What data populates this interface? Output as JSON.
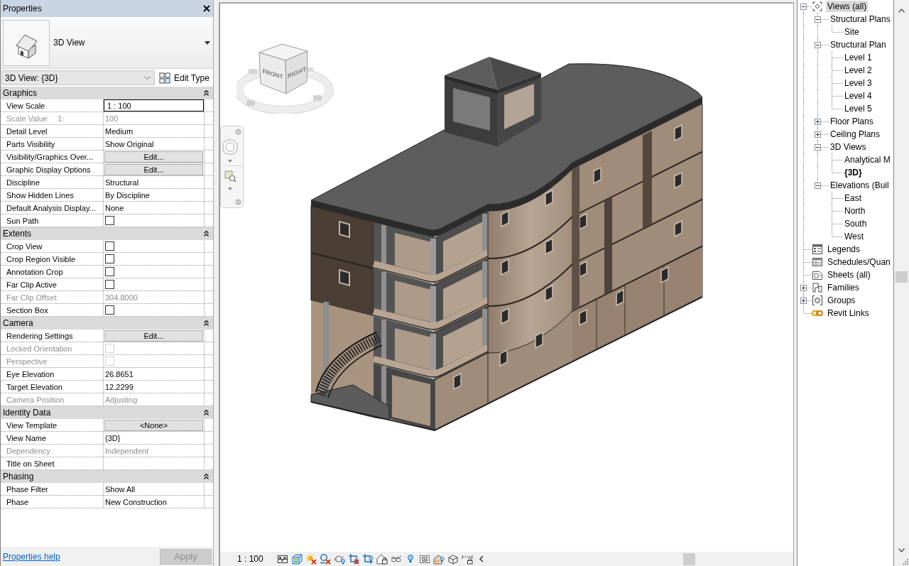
{
  "properties": {
    "title": "Properties",
    "type": {
      "name": "3D View"
    },
    "instance": {
      "value": "3D View: {3D}"
    },
    "edit_type": "Edit Type",
    "groups": [
      {
        "name": "Graphics",
        "expanded": true,
        "rows": [
          {
            "label": "View Scale",
            "kind": "input",
            "value": "1 : 100",
            "disabled": false
          },
          {
            "label": "Scale Value",
            "unit": "1:",
            "kind": "text",
            "value": "100",
            "disabled": true
          },
          {
            "label": "Detail Level",
            "kind": "text",
            "value": "Medium",
            "disabled": false
          },
          {
            "label": "Parts Visibility",
            "kind": "text",
            "value": "Show Original",
            "disabled": false
          },
          {
            "label": "Visibility/Graphics Over...",
            "kind": "button",
            "value": "Edit...",
            "disabled": false
          },
          {
            "label": "Graphic Display Options",
            "kind": "button",
            "value": "Edit...",
            "disabled": false
          },
          {
            "label": "Discipline",
            "kind": "text",
            "value": "Structural",
            "disabled": false
          },
          {
            "label": "Show Hidden Lines",
            "kind": "text",
            "value": "By Discipline",
            "disabled": false
          },
          {
            "label": "Default Analysis Display...",
            "kind": "text",
            "value": "None",
            "disabled": false
          },
          {
            "label": "Sun Path",
            "kind": "checkbox",
            "checked": false,
            "disabled": false
          }
        ]
      },
      {
        "name": "Extents",
        "expanded": true,
        "rows": [
          {
            "label": "Crop View",
            "kind": "checkbox",
            "checked": false,
            "disabled": false
          },
          {
            "label": "Crop Region Visible",
            "kind": "checkbox",
            "checked": false,
            "disabled": false
          },
          {
            "label": "Annotation Crop",
            "kind": "checkbox",
            "checked": false,
            "disabled": false
          },
          {
            "label": "Far Clip Active",
            "kind": "checkbox",
            "checked": false,
            "disabled": false
          },
          {
            "label": "Far Clip Offset",
            "kind": "text",
            "value": "304.8000",
            "disabled": true
          },
          {
            "label": "Section Box",
            "kind": "checkbox",
            "checked": false,
            "disabled": false
          }
        ]
      },
      {
        "name": "Camera",
        "expanded": true,
        "rows": [
          {
            "label": "Rendering Settings",
            "kind": "button",
            "value": "Edit...",
            "disabled": false
          },
          {
            "label": "Locked Orientation",
            "kind": "checkbox",
            "checked": false,
            "disabled": true
          },
          {
            "label": "Perspective",
            "kind": "checkbox",
            "checked": false,
            "disabled": true
          },
          {
            "label": "Eye Elevation",
            "kind": "text",
            "value": "26.8651",
            "disabled": false
          },
          {
            "label": "Target Elevation",
            "kind": "text",
            "value": "12.2299",
            "disabled": false
          },
          {
            "label": "Camera Position",
            "kind": "text",
            "value": "Adjusting",
            "disabled": true
          }
        ]
      },
      {
        "name": "Identity Data",
        "expanded": true,
        "rows": [
          {
            "label": "View Template",
            "kind": "button",
            "value": "<None>",
            "disabled": false
          },
          {
            "label": "View Name",
            "kind": "text",
            "value": "{3D}",
            "disabled": false
          },
          {
            "label": "Dependency",
            "kind": "text",
            "value": "Independent",
            "disabled": true
          },
          {
            "label": "Title on Sheet",
            "kind": "text",
            "disabled": false
          }
        ]
      },
      {
        "name": "Phasing",
        "expanded": true,
        "rows": [
          {
            "label": "Phase Filter",
            "kind": "text",
            "value": "Show All",
            "disabled": false
          },
          {
            "label": "Phase",
            "kind": "text",
            "value": "New Construction",
            "disabled": false
          }
        ]
      }
    ],
    "help_link": "Properties help",
    "apply": {
      "label": "Apply",
      "disabled": true
    }
  },
  "viewport": {
    "view_cube": {
      "faces": [
        "FRONT",
        "RIGHT"
      ]
    },
    "view_scale": "1 : 100"
  },
  "project_browser": {
    "items": [
      {
        "label": "Views (all)",
        "kind": "views",
        "expanded": true,
        "selected": true,
        "active": false,
        "children": [
          {
            "label": "Structural Plans",
            "expanded": true,
            "selected": false,
            "active": false,
            "children": [
              {
                "label": "Site",
                "selected": false,
                "active": false
              }
            ]
          },
          {
            "label": "Structural Plan",
            "expanded": true,
            "selected": false,
            "active": false,
            "children": [
              {
                "label": "Level 1",
                "selected": false,
                "active": false
              },
              {
                "label": "Level 2",
                "selected": false,
                "active": false
              },
              {
                "label": "Level 3",
                "selected": false,
                "active": false
              },
              {
                "label": "Level 4",
                "selected": false,
                "active": false
              },
              {
                "label": "Level 5",
                "selected": false,
                "active": false
              }
            ]
          },
          {
            "label": "Floor Plans",
            "expanded": false,
            "selected": false,
            "active": false
          },
          {
            "label": "Ceiling Plans",
            "expanded": false,
            "selected": false,
            "active": false
          },
          {
            "label": "3D Views",
            "expanded": true,
            "selected": false,
            "active": false,
            "children": [
              {
                "label": "Analytical M",
                "selected": false,
                "active": false
              },
              {
                "label": "{3D}",
                "selected": false,
                "active": true
              }
            ]
          },
          {
            "label": "Elevations (Buil",
            "expanded": true,
            "selected": false,
            "active": false,
            "children": [
              {
                "label": "East",
                "selected": false,
                "active": false
              },
              {
                "label": "North",
                "selected": false,
                "active": false
              },
              {
                "label": "South",
                "selected": false,
                "active": false
              },
              {
                "label": "West",
                "selected": false,
                "active": false
              }
            ]
          }
        ]
      },
      {
        "label": "Legends",
        "kind": "legends",
        "selected": false,
        "active": false
      },
      {
        "label": "Schedules/Quan",
        "kind": "schedules",
        "selected": false,
        "active": false
      },
      {
        "label": "Sheets (all)",
        "kind": "sheets",
        "selected": false,
        "active": false
      },
      {
        "label": "Families",
        "kind": "families",
        "expanded": false,
        "selected": false,
        "active": false
      },
      {
        "label": "Groups",
        "kind": "groups",
        "expanded": false,
        "selected": false,
        "active": false
      },
      {
        "label": "Revit Links",
        "kind": "links",
        "selected": false,
        "active": false
      }
    ]
  }
}
